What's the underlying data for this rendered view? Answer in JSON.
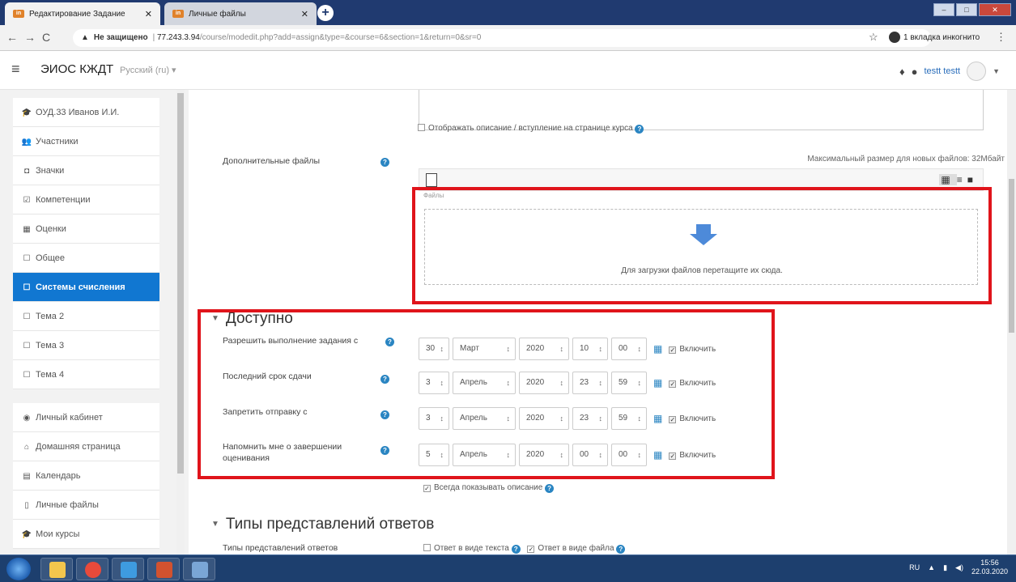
{
  "browser": {
    "tabs": [
      {
        "label": "Редактирование Задание"
      },
      {
        "label": "Личные файлы"
      }
    ],
    "address": {
      "warning": "Не защищено",
      "host": "77.243.3.94",
      "path": "/course/modedit.php?add=assign&type=&course=6&section=1&return=0&sr=0"
    },
    "incognito_label": "1 вкладка инкогнито"
  },
  "header": {
    "brand": "ЭИОС КЖДТ",
    "language": "Русский (ru) ▾",
    "user": "testt testt"
  },
  "sidebar": {
    "items": [
      {
        "label": "ОУД.33 Иванов И.И.",
        "icon": "graduation-cap-icon"
      },
      {
        "label": "Участники",
        "icon": "users-icon"
      },
      {
        "label": "Значки",
        "icon": "badge-icon"
      },
      {
        "label": "Компетенции",
        "icon": "check-square-icon"
      },
      {
        "label": "Оценки",
        "icon": "table-icon"
      },
      {
        "label": "Общее",
        "icon": "folder-icon"
      },
      {
        "label": "Системы счисления",
        "icon": "folder-icon",
        "active": true
      },
      {
        "label": "Тема 2",
        "icon": "folder-icon"
      },
      {
        "label": "Тема 3",
        "icon": "folder-icon"
      },
      {
        "label": "Тема 4",
        "icon": "folder-icon"
      }
    ],
    "items2": [
      {
        "label": "Личный кабинет",
        "icon": "dashboard-icon"
      },
      {
        "label": "Домашняя страница",
        "icon": "home-icon"
      },
      {
        "label": "Календарь",
        "icon": "calendar-icon"
      },
      {
        "label": "Личные файлы",
        "icon": "file-icon"
      },
      {
        "label": "Мои курсы",
        "icon": "graduation-cap-icon"
      }
    ]
  },
  "form": {
    "show_description": "Отображать описание / вступление на странице курса",
    "extra_files_label": "Дополнительные файлы",
    "max_size": "Максимальный размер для новых файлов: 32Мбайт",
    "files_label": "Файлы",
    "dropzone_text": "Для загрузки файлов перетащите их сюда.",
    "availability_title": "Доступно",
    "dates": [
      {
        "label": "Разрешить выполнение задания с",
        "day": "30",
        "month": "Март",
        "year": "2020",
        "hour": "10",
        "minute": "00",
        "enable": "Включить"
      },
      {
        "label": "Последний срок сдачи",
        "day": "3",
        "month": "Апрель",
        "year": "2020",
        "hour": "23",
        "minute": "59",
        "enable": "Включить"
      },
      {
        "label": "Запретить отправку с",
        "day": "3",
        "month": "Апрель",
        "year": "2020",
        "hour": "23",
        "minute": "59",
        "enable": "Включить"
      },
      {
        "label": "Напомнить мне о завершении оценивания",
        "day": "5",
        "month": "Апрель",
        "year": "2020",
        "hour": "00",
        "minute": "00",
        "enable": "Включить"
      }
    ],
    "always_show": "Всегда показывать описание",
    "submission_title": "Типы представлений ответов",
    "submission_types_label": "Типы представлений ответов",
    "online_text": "Ответ в виде текста",
    "file_submission": "Ответ в виде файла"
  },
  "taskbar": {
    "lang": "RU",
    "time": "15:56",
    "date": "22.03.2020"
  },
  "colors": {
    "active_item": "#1177d1",
    "highlight": "#e0141b",
    "help": "#2a85c2"
  }
}
